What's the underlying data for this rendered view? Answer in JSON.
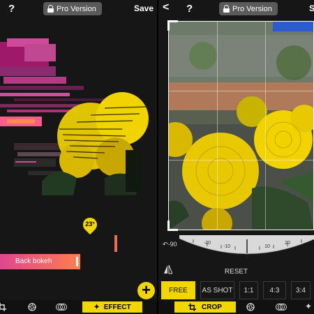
{
  "left_panel": {
    "topbar": {
      "help_icon": "?",
      "pro_label": "Pro Version",
      "save_label": "Save"
    },
    "angle_badge": "23°",
    "effect_name": "Back bokeh",
    "add_icon": "+",
    "tabs": {
      "crop_icon": "crop-icon",
      "aperture_icon": "aperture-icon",
      "layers_icon": "layers-icon",
      "effect_label": "EFFECT"
    }
  },
  "right_panel": {
    "topbar": {
      "back_icon": "<",
      "help_icon": "?",
      "pro_label": "Pro Version",
      "save_label": "S"
    },
    "rotation": "-90",
    "dial_ticks": [
      "-20",
      "-10",
      "0",
      "10",
      "20"
    ],
    "reset_label": "RESET",
    "ratios": [
      {
        "label": "FREE",
        "active": true
      },
      {
        "label": "AS SHOT",
        "active": false
      },
      {
        "label": "1:1",
        "active": false
      },
      {
        "label": "4:3",
        "active": false
      },
      {
        "label": "3:4",
        "active": false
      }
    ],
    "tabs": {
      "crop_label": "CROP",
      "aperture_icon": "aperture-icon",
      "layers_icon": "layers-icon",
      "effect_icon": "effect-wand-icon"
    }
  },
  "colors": {
    "accent": "#f2d600",
    "gradient_start": "#e0468d",
    "gradient_end": "#ff7d4e",
    "panel_bg": "#161616"
  }
}
